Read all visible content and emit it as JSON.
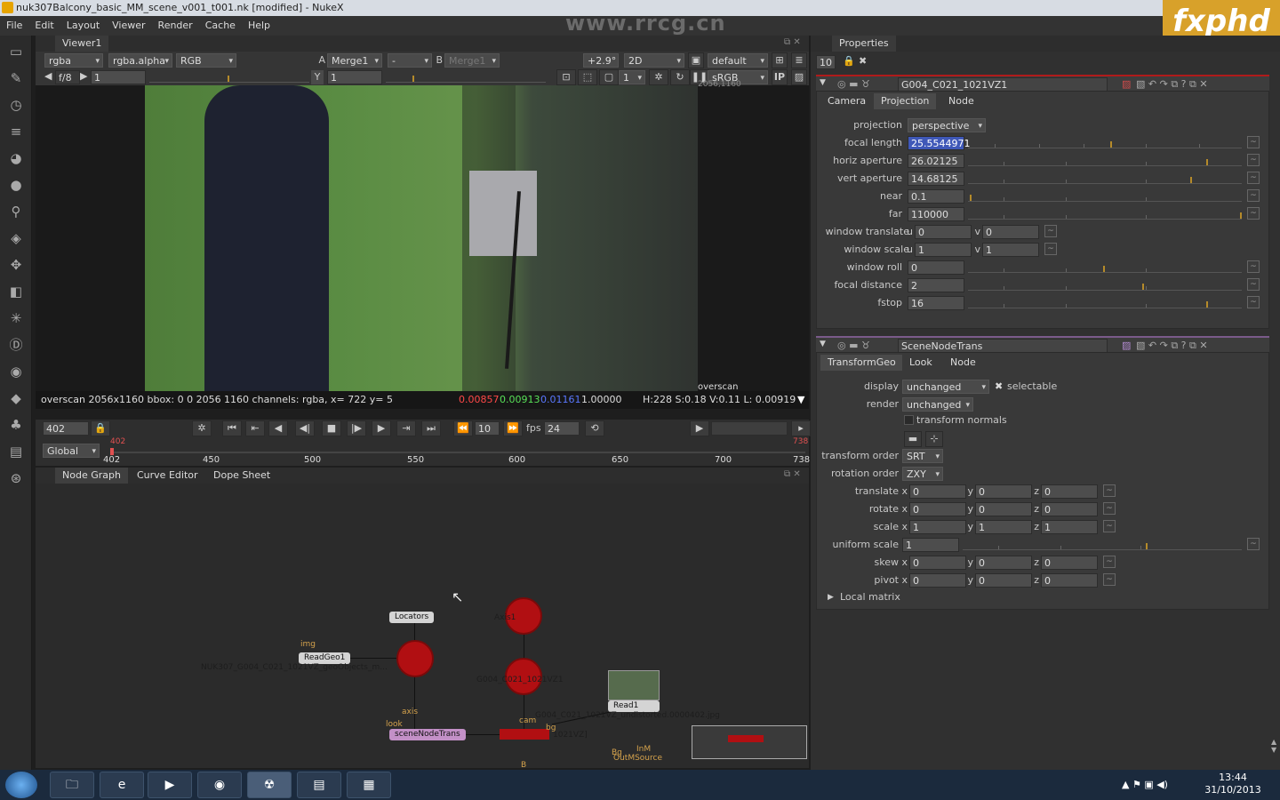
{
  "window": {
    "title": "nuk307Balcony_basic_MM_scene_v001_t001.nk [modified] - NukeX"
  },
  "menu": [
    "File",
    "Edit",
    "Layout",
    "Viewer",
    "Render",
    "Cache",
    "Help"
  ],
  "watermark": {
    "url": "www.rrcg.cn",
    "logo": "fxphd"
  },
  "viewer": {
    "tab": "Viewer1",
    "channels": "rgba",
    "alpha": "rgba.alpha",
    "rgb": "RGB",
    "a_input": "Merge1",
    "ab_mode": "-",
    "b_input": "Merge1",
    "gain_label": "+2.9°",
    "view_mode": "2D",
    "lut_default": "default",
    "fstop": "f/8",
    "frame_field": "1",
    "y_label": "Y",
    "y_field": "1",
    "proxy": "1",
    "colorspace": "sRGB",
    "ip": "IP",
    "overscan_label": "overscan",
    "res_label": "2056,1160",
    "info": {
      "text": "overscan 2056x1160 bbox: 0 0 2056 1160 channels: rgba, x= 722 y=   5",
      "r": "0.00857",
      "g": "0.00913",
      "b": "0.01161",
      "a": "1.00000",
      "hsl": "H:228 S:0.18 V:0.11  L: 0.00919"
    }
  },
  "timeline": {
    "frame": "402",
    "step": "10",
    "fps_label": "fps",
    "fps": "24",
    "scope": "Global",
    "start": "402",
    "end": "738",
    "ticks": [
      "402",
      "450",
      "500",
      "550",
      "600",
      "650",
      "700",
      "738"
    ]
  },
  "bottom_tabs": [
    "Node Graph",
    "Curve Editor",
    "Dope Sheet"
  ],
  "nodegraph": {
    "nodes": [
      {
        "name": "ReadGeo1",
        "sub": "NUK307_G004_C021_1021VZ_geoObjects_m...",
        "input": "img"
      },
      {
        "name": "Locators"
      },
      {
        "name": "Axis1",
        "type": "axis"
      },
      {
        "name": "G004_C021_1021VZ1",
        "type": "camera"
      },
      {
        "name": "Read1",
        "sub": "G004_C021_1021VZ_undistorted.0000402.jpg"
      },
      {
        "name": "sceneNodeTrans",
        "type": "look"
      },
      {
        "name": "1021VZ]",
        "type": "scanline"
      },
      {
        "name": "InM",
        "sub": "OutMSource"
      }
    ],
    "pins": {
      "axis": "axis",
      "look": "look",
      "cam": "cam",
      "bg": "bg",
      "B": "B",
      "bg2": "Bg"
    }
  },
  "properties": {
    "title": "Properties",
    "max_panels": "10",
    "camera_node": {
      "name": "G004_C021_1021VZ1",
      "tabs": [
        "Camera",
        "Projection",
        "Node"
      ],
      "active_tab": "Projection",
      "fields": [
        {
          "label": "projection",
          "value": "perspective",
          "type": "dropdown"
        },
        {
          "label": "focal length",
          "value": "25.5544971",
          "highlight": true
        },
        {
          "label": "horiz aperture",
          "value": "26.02125"
        },
        {
          "label": "vert aperture",
          "value": "14.68125"
        },
        {
          "label": "near",
          "value": "0.1"
        },
        {
          "label": "far",
          "value": "110000"
        },
        {
          "label": "window translate",
          "u": "0",
          "v": "0"
        },
        {
          "label": "window scale",
          "u": "1",
          "v": "1"
        },
        {
          "label": "window roll",
          "value": "0"
        },
        {
          "label": "focal distance",
          "value": "2"
        },
        {
          "label": "fstop",
          "value": "16"
        }
      ]
    },
    "trans_node": {
      "name": "SceneNodeTrans",
      "tabs": [
        "TransformGeo",
        "Look",
        "Node"
      ],
      "display_label": "display",
      "display": "unchanged",
      "selectable": "selectable",
      "render_label": "render",
      "render": "unchanged",
      "transform_normals": "transform normals",
      "transform_order_label": "transform order",
      "transform_order": "SRT",
      "rotation_order_label": "rotation order",
      "rotation_order": "ZXY",
      "xyz": [
        {
          "label": "translate",
          "x": "0",
          "y": "0",
          "z": "0"
        },
        {
          "label": "rotate",
          "x": "0",
          "y": "0",
          "z": "0"
        },
        {
          "label": "scale",
          "x": "1",
          "y": "1",
          "z": "1"
        }
      ],
      "uniform_scale_label": "uniform scale",
      "uniform_scale": "1",
      "xyz2": [
        {
          "label": "skew",
          "x": "0",
          "y": "0",
          "z": "0"
        },
        {
          "label": "pivot",
          "x": "0",
          "y": "0",
          "z": "0"
        }
      ],
      "local_matrix": "Local matrix"
    }
  },
  "taskbar": {
    "time": "13:44",
    "date": "31/10/2013"
  }
}
